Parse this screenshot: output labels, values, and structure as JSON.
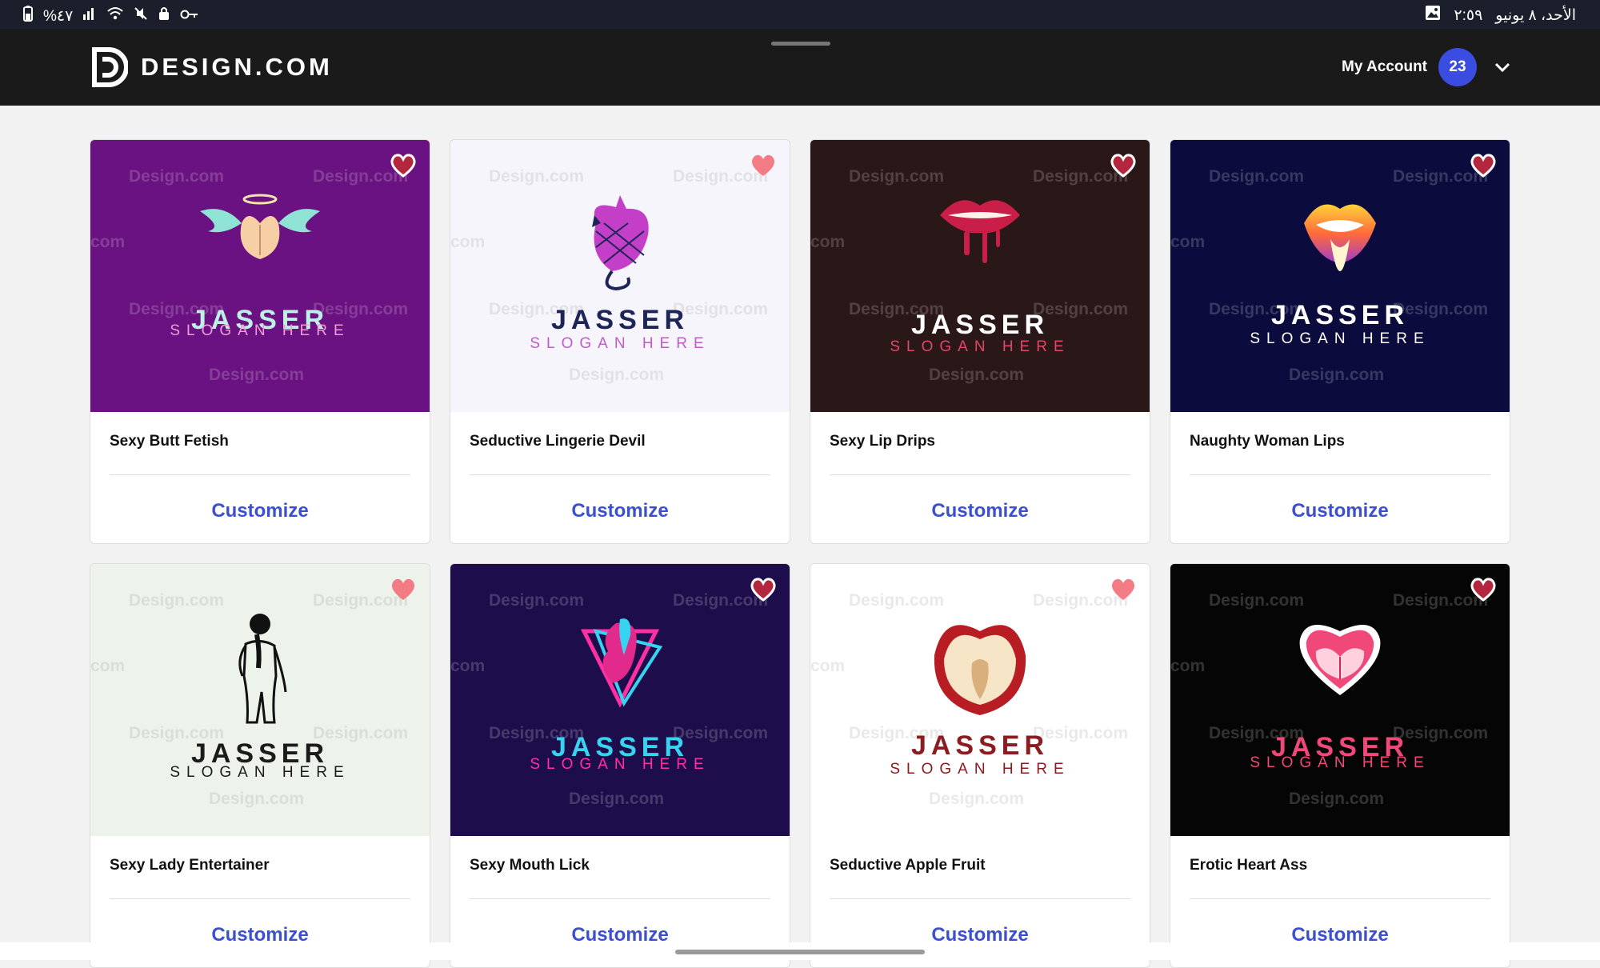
{
  "status_bar": {
    "left_text": "%٤٧",
    "right_date": "الأحد، ٨ يونيو",
    "right_time": "٢:٥٩"
  },
  "header": {
    "logo_text": "DESIGN.COM",
    "account_label": "My Account",
    "account_badge": "23"
  },
  "watermark": "Design.com",
  "customize_label": "Customize",
  "cards": [
    {
      "title": "Sexy Butt Fetish",
      "brand": "JASSER",
      "slogan": "SLOGAN HERE",
      "bg": "#6a1282",
      "brand_color": "#bff0e6",
      "slogan_color": "#f29ad8",
      "heart_filled": true,
      "icon": "winged-butt-icon"
    },
    {
      "title": "Seductive Lingerie Devil",
      "brand": "JASSER",
      "slogan": "SLOGAN HERE",
      "bg": "#f6f5fb",
      "brand_color": "#1d2456",
      "slogan_color": "#c05cc8",
      "heart_filled": false,
      "icon": "lingerie-devil-icon"
    },
    {
      "title": "Sexy Lip Drips",
      "brand": "JASSER",
      "slogan": "SLOGAN HERE",
      "bg": "#2a1718",
      "brand_color": "#ffffff",
      "slogan_color": "#e0466a",
      "heart_filled": true,
      "icon": "dripping-lips-icon"
    },
    {
      "title": "Naughty Woman Lips",
      "brand": "JASSER",
      "slogan": "SLOGAN HERE",
      "bg": "#0b0b3e",
      "brand_color": "#ffffff",
      "slogan_color": "#ffffff",
      "heart_filled": true,
      "icon": "rainbow-lips-icon"
    },
    {
      "title": "Sexy Lady Entertainer",
      "brand": "JASSER",
      "slogan": "SLOGAN HERE",
      "bg": "#edf2ea",
      "brand_color": "#1b1b1b",
      "slogan_color": "#1b1b1b",
      "heart_filled": false,
      "icon": "lady-silhouette-icon"
    },
    {
      "title": "Sexy Mouth Lick",
      "brand": "JASSER",
      "slogan": "SLOGAN HERE",
      "bg": "#1d0d4a",
      "brand_color": "#37d3f0",
      "slogan_color": "#ff2fa4",
      "heart_filled": true,
      "icon": "mouth-lick-icon"
    },
    {
      "title": "Seductive Apple Fruit",
      "brand": "JASSER",
      "slogan": "SLOGAN HERE",
      "bg": "#ffffff",
      "brand_color": "#8c1c20",
      "slogan_color": "#8c1c20",
      "heart_filled": false,
      "icon": "apple-fruit-icon"
    },
    {
      "title": "Erotic Heart Ass",
      "brand": "JASSER",
      "slogan": "SLOGAN HERE",
      "bg": "#050505",
      "brand_color": "#f1487a",
      "slogan_color": "#f1487a",
      "heart_filled": true,
      "icon": "heart-ass-icon"
    }
  ]
}
